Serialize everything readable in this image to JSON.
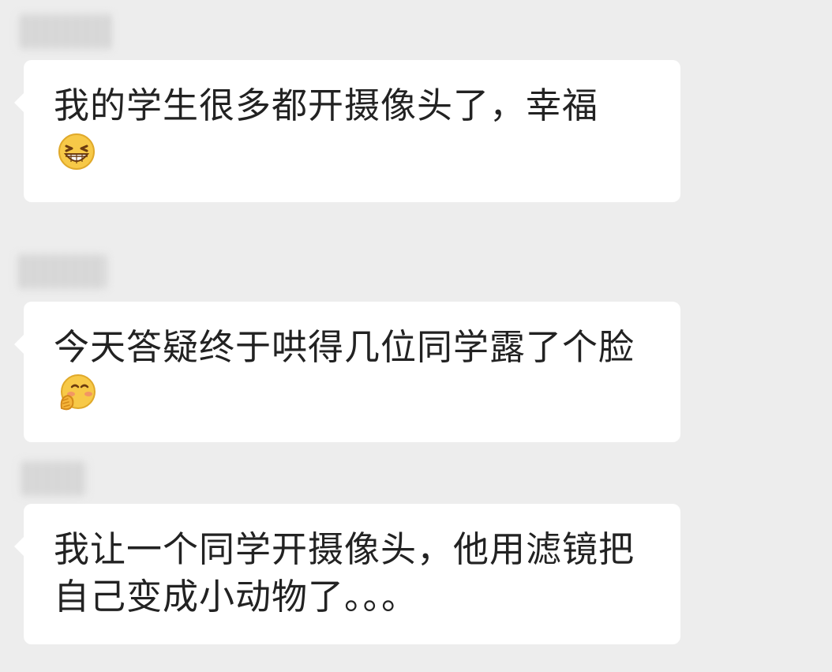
{
  "messages": [
    {
      "text": "我的学生很多都开摄像头了，幸福",
      "emoji": "grinning-squint-icon"
    },
    {
      "text": "今天答疑终于哄得几位同学露了个脸",
      "emoji": "shy-covering-mouth-icon"
    },
    {
      "text": "我让一个同学开摄像头，他用滤镜把自己变成小动物了。。。",
      "emoji": ""
    }
  ],
  "colors": {
    "background": "#ededed",
    "bubble": "#ffffff",
    "text": "#222222",
    "emoji_face": "#f7c948"
  }
}
